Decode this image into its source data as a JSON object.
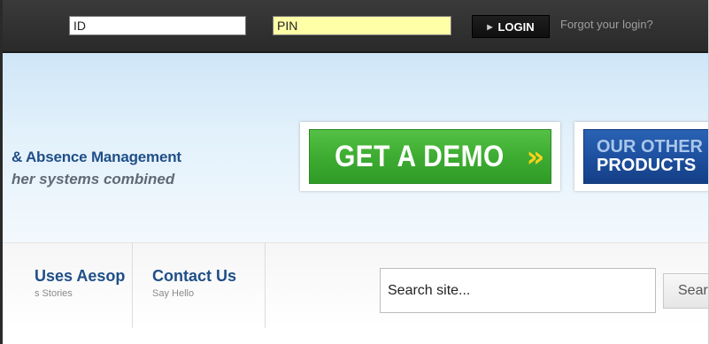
{
  "login_bar": {
    "id_value": "ID",
    "pin_value": "PIN",
    "login_label": "LOGIN",
    "forgot_label": "Forgot your login?"
  },
  "banner": {
    "tagline_line1": "& Absence Management",
    "tagline_line2": "her systems combined",
    "demo_label": "GET A DEMO",
    "demo_chevrons": "»",
    "products_line1": "OUR OTHER",
    "products_line2": "PRODUCTS"
  },
  "nav": {
    "items": [
      {
        "title": "Uses Aesop",
        "subtitle": "s Stories"
      },
      {
        "title": "Contact Us",
        "subtitle": "Say Hello"
      }
    ]
  },
  "search": {
    "placeholder": "Search site...",
    "button_label": "Sear"
  },
  "colors": {
    "topbar": "#2f2f2f",
    "pin_field_bg": "#ffffa8",
    "demo_green": "#3fae33",
    "demo_chevron": "#ffd21a",
    "products_blue": "#1d4f9e",
    "brand_blue_text": "#1f4f88"
  }
}
